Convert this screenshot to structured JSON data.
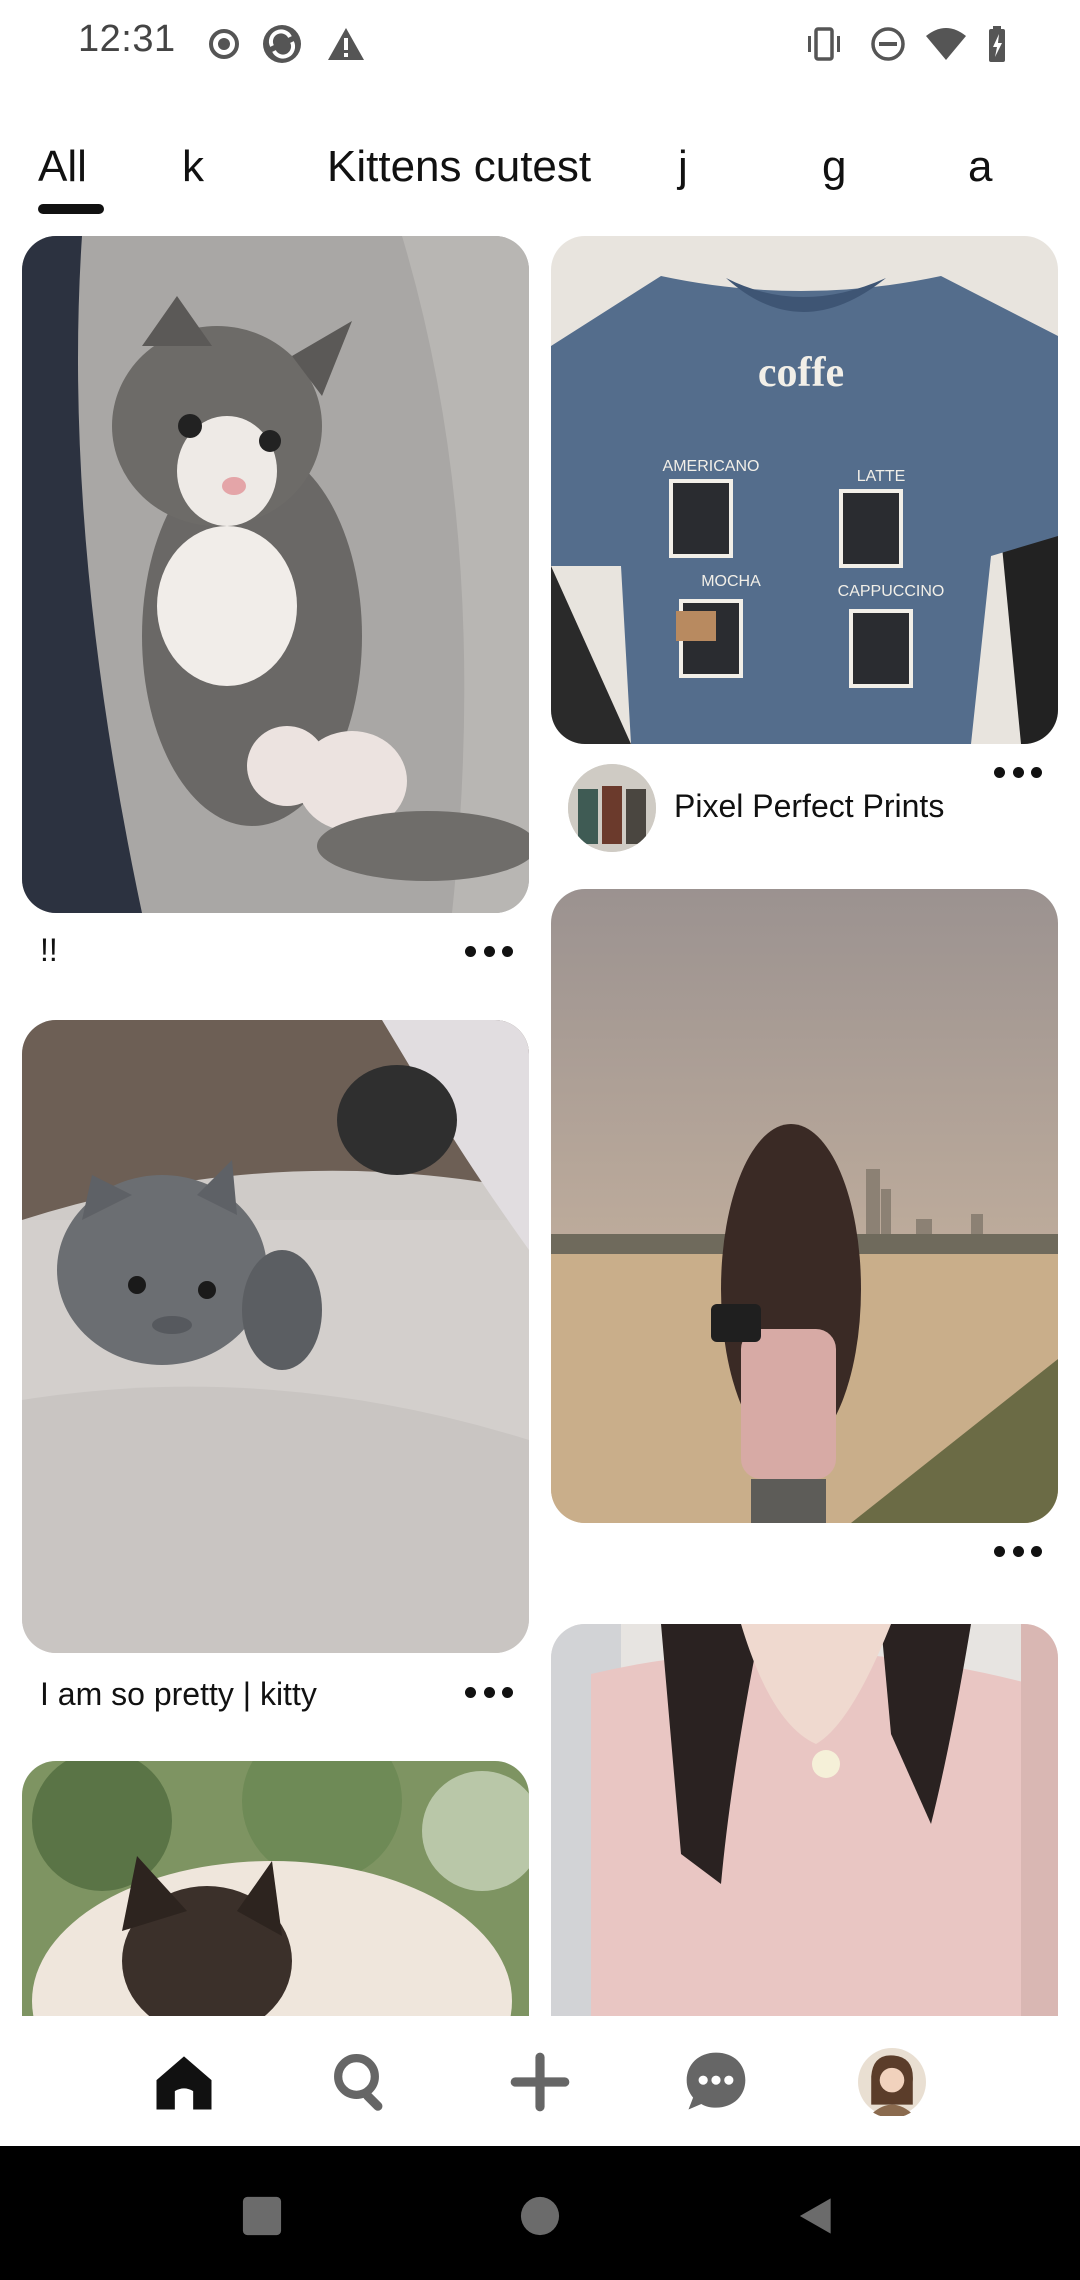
{
  "status_bar": {
    "time": "12:31",
    "left_icons": [
      "record-icon",
      "sync-icon",
      "warning-icon"
    ],
    "right_icons": [
      "vibrate-icon",
      "do-not-disturb-icon",
      "wifi-icon",
      "battery-icon"
    ]
  },
  "tabs": {
    "items": [
      {
        "label": "All",
        "active": true
      },
      {
        "label": "k",
        "active": false
      },
      {
        "label": "Kittens cutest",
        "active": false
      },
      {
        "label": "j",
        "active": false
      },
      {
        "label": "g",
        "active": false
      },
      {
        "label": "a",
        "active": false
      }
    ]
  },
  "feed": {
    "left_column": [
      {
        "image": "gray-kitten-lying-on-back",
        "caption": "!!"
      },
      {
        "image": "gray-kitten-on-blanket",
        "caption": "I am so pretty | kitty"
      },
      {
        "image": "siamese-cat-outdoors",
        "caption": ""
      }
    ],
    "right_column": [
      {
        "image": "coffee-cats-tshirt",
        "creator": "Pixel Perfect Prints",
        "shirt_text": {
          "title": "coffe",
          "labels": [
            "AMERICANO",
            "LATTE",
            "MOCHA",
            "CAPPUCCINO"
          ]
        }
      },
      {
        "image": "girl-with-camera-by-river",
        "caption": ""
      },
      {
        "image": "woman-in-pink-top",
        "caption": ""
      }
    ]
  },
  "bottom_nav": {
    "items": [
      "home-icon",
      "search-icon",
      "create-icon",
      "messages-icon",
      "profile-avatar"
    ]
  },
  "system_nav": {
    "items": [
      "recents-button",
      "home-button",
      "back-button"
    ]
  }
}
